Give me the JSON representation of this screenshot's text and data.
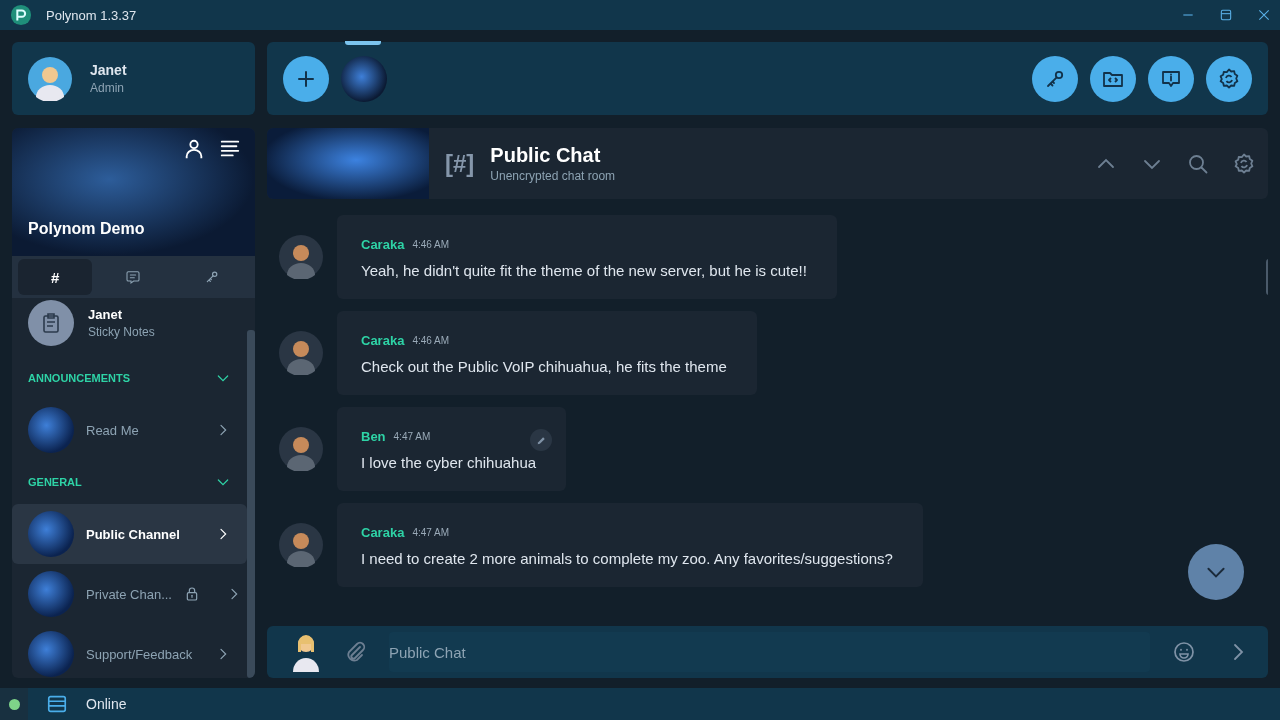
{
  "window": {
    "title": "Polynom 1.3.37"
  },
  "user": {
    "name": "Janet",
    "role": "Admin"
  },
  "servers": [
    {
      "selected": true
    }
  ],
  "server": {
    "name": "Polynom Demo"
  },
  "sidebar_tabs": [
    {
      "kind": "hash",
      "label": "#",
      "selected": true
    },
    {
      "kind": "chat",
      "selected": false
    },
    {
      "kind": "key",
      "selected": false
    }
  ],
  "notes": {
    "title": "Janet",
    "subtitle": "Sticky Notes"
  },
  "categories": [
    {
      "name": "ANNOUNCEMENTS",
      "expanded": true,
      "channels": [
        {
          "name": "Read Me",
          "selected": false,
          "locked": false
        }
      ]
    },
    {
      "name": "GENERAL",
      "expanded": true,
      "channels": [
        {
          "name": "Public Channel",
          "selected": true,
          "locked": false
        },
        {
          "name": "Private Chan...",
          "selected": false,
          "locked": true
        },
        {
          "name": "Support/Feedback",
          "selected": false,
          "locked": false
        }
      ]
    }
  ],
  "chat": {
    "icon_text": "[#]",
    "title": "Public Chat",
    "subtitle": "Unencrypted chat room"
  },
  "messages": [
    {
      "author": "Caraka",
      "time": "4:46 AM",
      "text": "Yeah, he didn't quite fit the theme of the new server, but he is cute!!",
      "hovered": false
    },
    {
      "author": "Caraka",
      "time": "4:46 AM",
      "text": "Check out the Public VoIP chihuahua, he fits the theme",
      "hovered": false
    },
    {
      "author": "Ben",
      "time": "4:47 AM",
      "text": "I love the cyber chihuahua",
      "hovered": true
    },
    {
      "author": "Caraka",
      "time": "4:47 AM",
      "text": "I need to create 2 more animals to complete my zoo. Any favorites/suggestions?",
      "hovered": false
    }
  ],
  "composer": {
    "placeholder": "Public Chat"
  },
  "status_bar": {
    "online": true,
    "label": "Online"
  }
}
